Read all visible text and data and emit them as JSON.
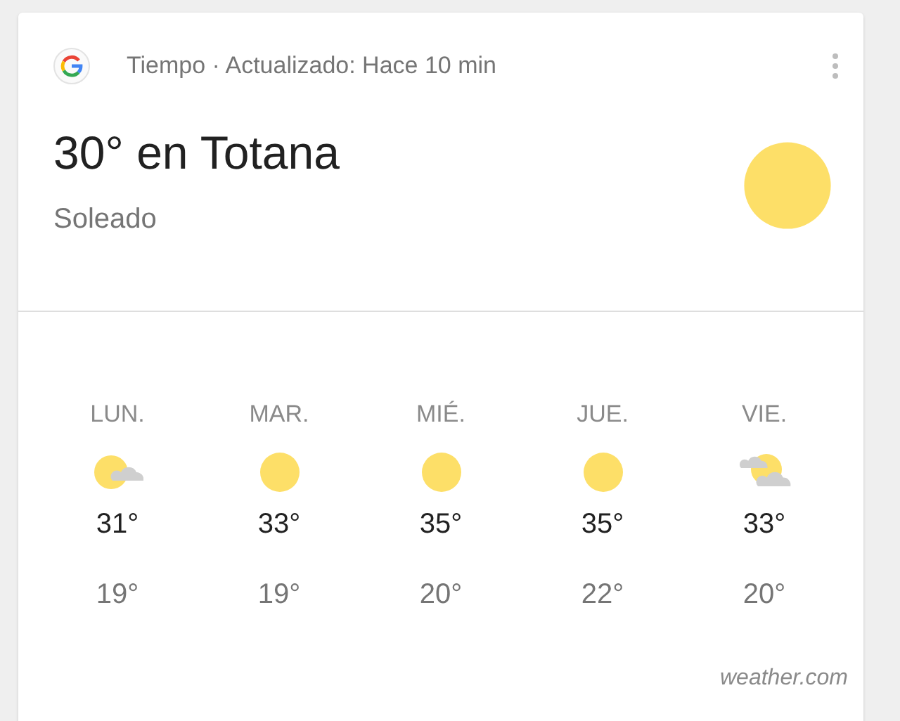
{
  "header": {
    "title": "Tiempo · Actualizado: Hace 10 min"
  },
  "current": {
    "headline": "30° en Totana",
    "condition": "Soleado",
    "kind": "sunny"
  },
  "forecast": [
    {
      "day": "LUN.",
      "kind": "partly_cloudy",
      "high": "31°",
      "low": "19°"
    },
    {
      "day": "MAR.",
      "kind": "sunny",
      "high": "33°",
      "low": "19°"
    },
    {
      "day": "MIÉ.",
      "kind": "sunny",
      "high": "35°",
      "low": "20°"
    },
    {
      "day": "JUE.",
      "kind": "sunny",
      "high": "35°",
      "low": "22°"
    },
    {
      "day": "VIE.",
      "kind": "mostly_cloudy",
      "high": "33°",
      "low": "20°"
    }
  ],
  "attribution": "weather.com"
}
